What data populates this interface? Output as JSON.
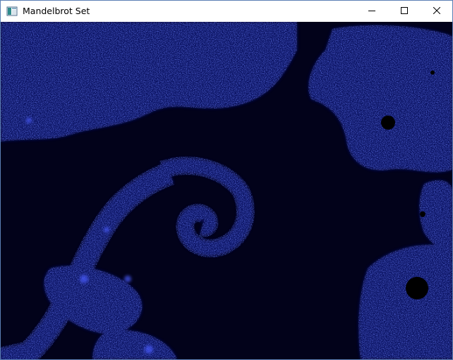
{
  "window": {
    "title": "Mandelbrot Set",
    "app_icon": "window-app-icon",
    "buttons": {
      "minimize_icon": "minimize-icon",
      "maximize_icon": "maximize-icon",
      "close_icon": "close-icon"
    }
  },
  "canvas": {
    "background_color": "#02021a",
    "fractal_color": "#1f2fd8",
    "highlight_color": "#4a5cff"
  }
}
